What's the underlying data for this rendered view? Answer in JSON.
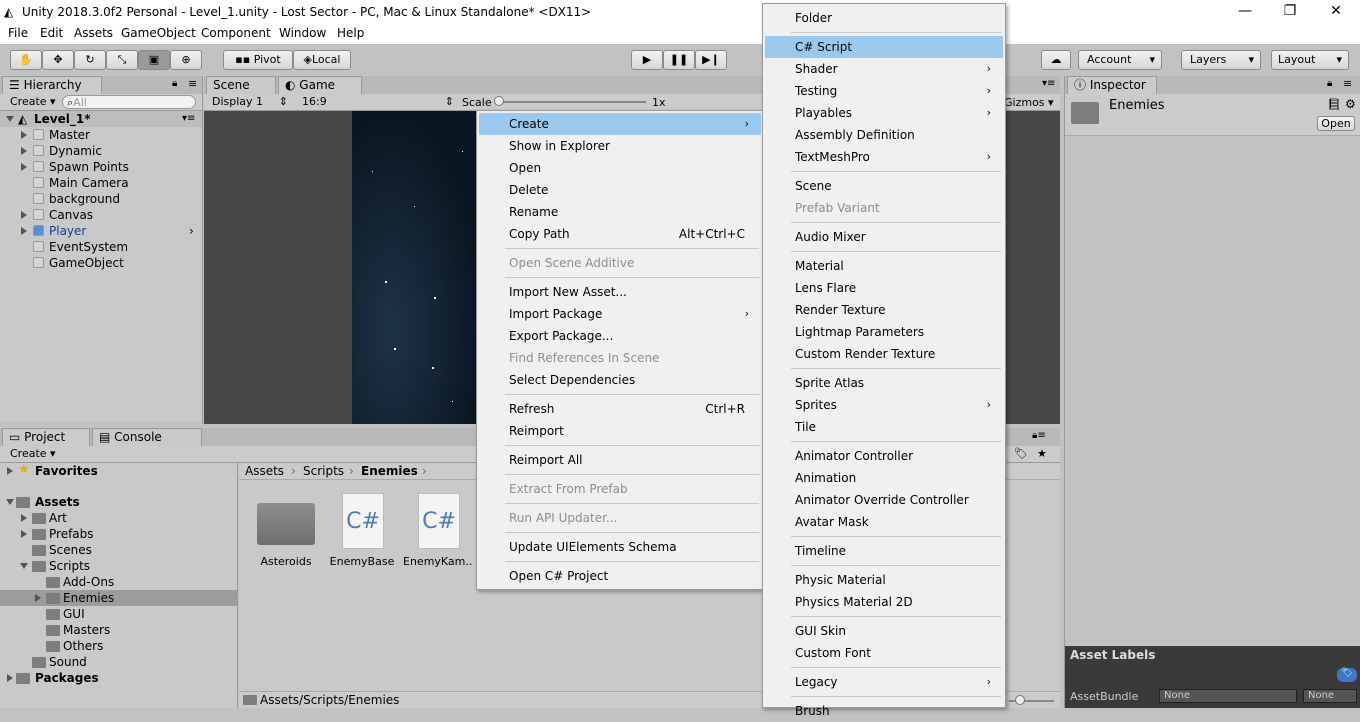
{
  "window": {
    "title": "Unity 2018.3.0f2 Personal - Level_1.unity - Lost Sector - PC, Mac & Linux Standalone* <DX11>",
    "minimize": "—",
    "maximize": "❐",
    "close": "✕"
  },
  "menubar": [
    "File",
    "Edit",
    "Assets",
    "GameObject",
    "Component",
    "Window",
    "Help"
  ],
  "toolbar": {
    "pivot": "Pivot",
    "local": "Local",
    "account": "Account",
    "layers": "Layers",
    "layout": "Layout"
  },
  "hierarchy": {
    "tab": "Hierarchy",
    "create": "Create",
    "search_placeholder": "All",
    "scene": "Level_1*",
    "items": [
      {
        "label": "Master",
        "expandable": true
      },
      {
        "label": "Dynamic",
        "expandable": true
      },
      {
        "label": "Spawn Points",
        "expandable": true
      },
      {
        "label": "Main Camera",
        "expandable": false
      },
      {
        "label": "background",
        "expandable": false
      },
      {
        "label": "Canvas",
        "expandable": true
      },
      {
        "label": "Player",
        "expandable": true
      },
      {
        "label": "EventSystem",
        "expandable": false
      },
      {
        "label": "GameObject",
        "expandable": false
      }
    ]
  },
  "scene_tabs": {
    "scene": "Scene",
    "game": "Game",
    "display": "Display 1",
    "aspect": "16:9",
    "scale_label": "Scale",
    "scale_value": "1x",
    "gizmos": "Gizmos"
  },
  "inspector": {
    "tab": "Inspector",
    "object_name": "Enemies",
    "open_button": "Open",
    "asset_labels": "Asset Labels",
    "assetbundle_label": "AssetBundle",
    "assetbundle_value": "None",
    "assetbundle_variant": "None"
  },
  "project": {
    "tab_project": "Project",
    "tab_console": "Console",
    "create": "Create",
    "favorites": "Favorites",
    "assets_root": "Assets",
    "folders": [
      {
        "label": "Art",
        "depth": 1,
        "expandable": true
      },
      {
        "label": "Prefabs",
        "depth": 1,
        "expandable": true
      },
      {
        "label": "Scenes",
        "depth": 1,
        "expandable": false
      },
      {
        "label": "Scripts",
        "depth": 1,
        "expandable": true
      },
      {
        "label": "Add-Ons",
        "depth": 2,
        "expandable": false
      },
      {
        "label": "Enemies",
        "depth": 2,
        "expandable": true
      },
      {
        "label": "GUI",
        "depth": 2,
        "expandable": false
      },
      {
        "label": "Masters",
        "depth": 2,
        "expandable": false
      },
      {
        "label": "Others",
        "depth": 2,
        "expandable": false
      },
      {
        "label": "Sound",
        "depth": 1,
        "expandable": false
      }
    ],
    "packages": "Packages",
    "breadcrumb": [
      "Assets",
      "Scripts",
      "Enemies"
    ],
    "files": [
      {
        "label": "Asteroids",
        "type": "folder"
      },
      {
        "label": "EnemyBase",
        "type": "script"
      },
      {
        "label": "EnemyKam...",
        "type": "script"
      }
    ],
    "script_glyph": "C#",
    "status_path": "Assets/Scripts/Enemies"
  },
  "context_menu": {
    "items": [
      {
        "label": "Create",
        "submenu": true,
        "highlighted": true
      },
      {
        "label": "Show in Explorer"
      },
      {
        "label": "Open"
      },
      {
        "label": "Delete"
      },
      {
        "label": "Rename"
      },
      {
        "label": "Copy Path",
        "shortcut": "Alt+Ctrl+C"
      },
      {
        "separator": true
      },
      {
        "label": "Open Scene Additive",
        "disabled": true
      },
      {
        "separator": true
      },
      {
        "label": "Import New Asset..."
      },
      {
        "label": "Import Package",
        "submenu": true
      },
      {
        "label": "Export Package..."
      },
      {
        "label": "Find References In Scene",
        "disabled": true
      },
      {
        "label": "Select Dependencies"
      },
      {
        "separator": true
      },
      {
        "label": "Refresh",
        "shortcut": "Ctrl+R"
      },
      {
        "label": "Reimport"
      },
      {
        "separator": true
      },
      {
        "label": "Reimport All"
      },
      {
        "separator": true
      },
      {
        "label": "Extract From Prefab",
        "disabled": true
      },
      {
        "separator": true
      },
      {
        "label": "Run API Updater...",
        "disabled": true
      },
      {
        "separator": true
      },
      {
        "label": "Update UIElements Schema"
      },
      {
        "separator": true
      },
      {
        "label": "Open C# Project"
      }
    ]
  },
  "create_submenu": {
    "items": [
      {
        "label": "Folder"
      },
      {
        "separator": true
      },
      {
        "label": "C# Script",
        "highlighted": true
      },
      {
        "label": "Shader",
        "submenu": true
      },
      {
        "label": "Testing",
        "submenu": true
      },
      {
        "label": "Playables",
        "submenu": true
      },
      {
        "label": "Assembly Definition"
      },
      {
        "label": "TextMeshPro",
        "submenu": true
      },
      {
        "separator": true
      },
      {
        "label": "Scene"
      },
      {
        "label": "Prefab Variant",
        "disabled": true
      },
      {
        "separator": true
      },
      {
        "label": "Audio Mixer"
      },
      {
        "separator": true
      },
      {
        "label": "Material"
      },
      {
        "label": "Lens Flare"
      },
      {
        "label": "Render Texture"
      },
      {
        "label": "Lightmap Parameters"
      },
      {
        "label": "Custom Render Texture"
      },
      {
        "separator": true
      },
      {
        "label": "Sprite Atlas"
      },
      {
        "label": "Sprites",
        "submenu": true
      },
      {
        "label": "Tile"
      },
      {
        "separator": true
      },
      {
        "label": "Animator Controller"
      },
      {
        "label": "Animation"
      },
      {
        "label": "Animator Override Controller"
      },
      {
        "label": "Avatar Mask"
      },
      {
        "separator": true
      },
      {
        "label": "Timeline"
      },
      {
        "separator": true
      },
      {
        "label": "Physic Material"
      },
      {
        "label": "Physics Material 2D"
      },
      {
        "separator": true
      },
      {
        "label": "GUI Skin"
      },
      {
        "label": "Custom Font"
      },
      {
        "separator": true
      },
      {
        "label": "Legacy",
        "submenu": true
      },
      {
        "separator": true
      },
      {
        "label": "Brush"
      }
    ]
  }
}
